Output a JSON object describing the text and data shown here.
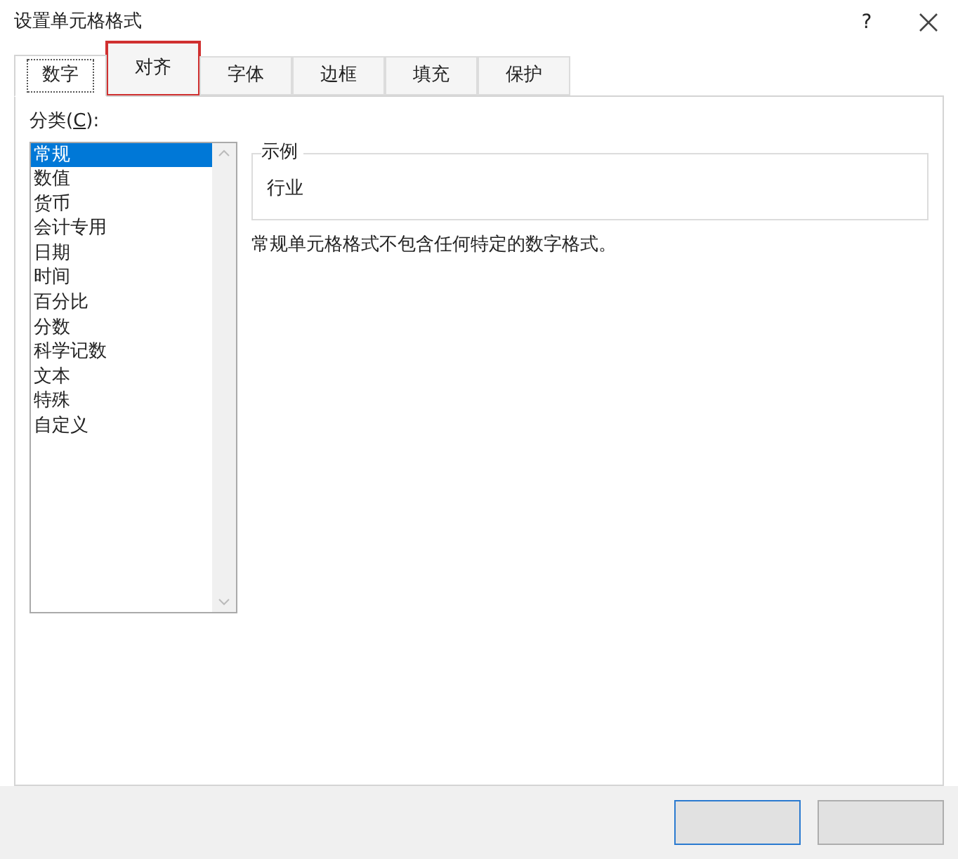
{
  "window": {
    "title": "设置单元格格式",
    "help": "?"
  },
  "tabs": [
    {
      "label": "数字",
      "selected": true,
      "highlighted": false
    },
    {
      "label": "对齐",
      "selected": false,
      "highlighted": true
    },
    {
      "label": "字体",
      "selected": false,
      "highlighted": false
    },
    {
      "label": "边框",
      "selected": false,
      "highlighted": false
    },
    {
      "label": "填充",
      "selected": false,
      "highlighted": false
    },
    {
      "label": "保护",
      "selected": false,
      "highlighted": false
    }
  ],
  "category": {
    "label_before": "分类(",
    "accesskey": "C",
    "label_after": "):",
    "items": [
      {
        "label": "常规",
        "selected": true
      },
      {
        "label": "数值",
        "selected": false
      },
      {
        "label": "货币",
        "selected": false
      },
      {
        "label": "会计专用",
        "selected": false
      },
      {
        "label": "日期",
        "selected": false
      },
      {
        "label": "时间",
        "selected": false
      },
      {
        "label": "百分比",
        "selected": false
      },
      {
        "label": "分数",
        "selected": false
      },
      {
        "label": "科学记数",
        "selected": false
      },
      {
        "label": "文本",
        "selected": false
      },
      {
        "label": "特殊",
        "selected": false
      },
      {
        "label": "自定义",
        "selected": false
      }
    ]
  },
  "sample": {
    "legend": "示例",
    "value": "行业"
  },
  "description": "常规单元格格式不包含任何特定的数字格式。",
  "buttons": [
    {
      "kind": "default"
    },
    {
      "kind": "normal"
    }
  ]
}
